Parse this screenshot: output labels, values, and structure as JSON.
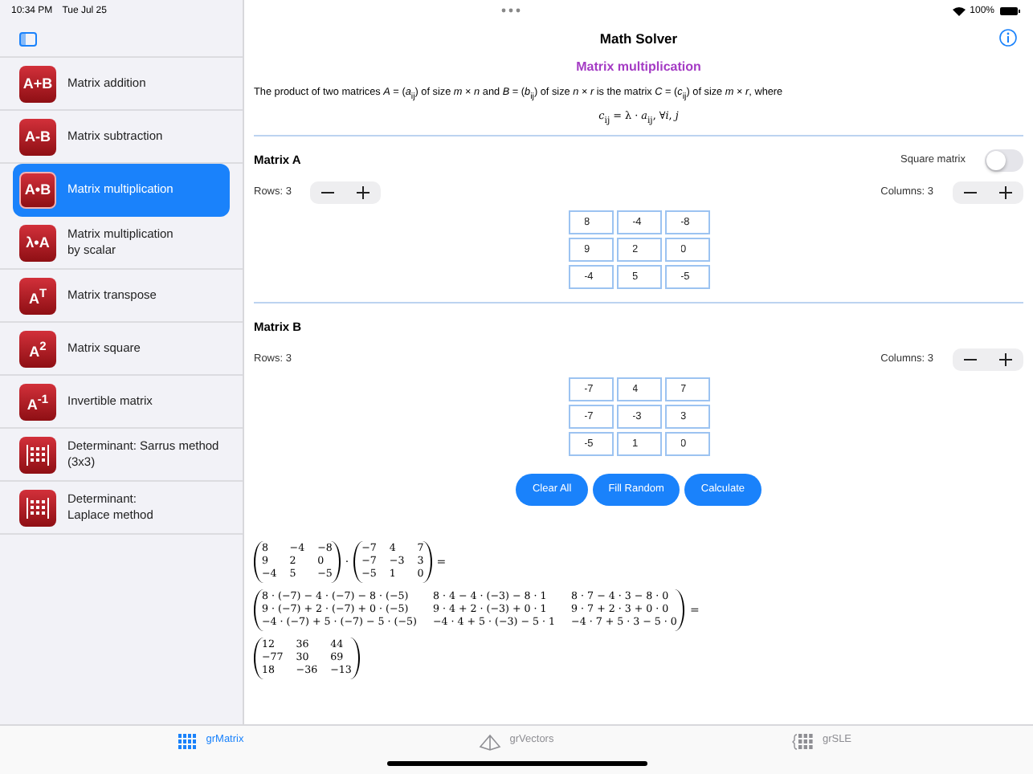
{
  "status_bar": {
    "time": "10:34 PM",
    "date": "Tue Jul 25",
    "battery": "100%"
  },
  "header": {
    "title": "Math Solver"
  },
  "sidebar": {
    "items": [
      {
        "kind": "text",
        "icon_text": "A+B",
        "label": "Matrix addition",
        "selected": false
      },
      {
        "kind": "text",
        "icon_text": "A-B",
        "label": "Matrix subtraction",
        "selected": false
      },
      {
        "kind": "text",
        "icon_text": "A•B",
        "label": "Matrix multiplication",
        "selected": true
      },
      {
        "kind": "text",
        "icon_text": "λ•A",
        "label": "Matrix multiplication\nby scalar",
        "selected": false
      },
      {
        "kind": "text",
        "icon_text": "A$^{T}$",
        "label": "Matrix transpose",
        "selected": false
      },
      {
        "kind": "text",
        "icon_text": "A$^{2}$",
        "label": "Matrix square",
        "selected": false
      },
      {
        "kind": "text",
        "icon_text": "A$^{-1}$",
        "label": "Invertible matrix",
        "selected": false
      },
      {
        "kind": "grid",
        "label": "Determinant: Sarrus method\n(3x3)",
        "selected": false
      },
      {
        "kind": "grid",
        "label": "Determinant:\nLaplace method",
        "selected": false
      }
    ]
  },
  "content": {
    "title": "Matrix multiplication",
    "description": "The product of two matrices *A* = (*a*$_{ij}$) of size *m* × *n* and *B* = (*b*$_{ij}$) of size *n* × *r* is the matrix *C* = (*c*$_{ij}$) of size *m* × *r*, where",
    "formula": "*c*$_{ij}$ = λ · *a*$_{ij}$, ∀*i*, *j*",
    "matrices": [
      {
        "title": "Matrix A",
        "square_toggle": {
          "label": "Square matrix",
          "on": false
        },
        "rows_label": "Rows: 3",
        "rows_stepper": true,
        "columns_label": "Columns: 3",
        "cells": [
          [
            "8",
            "-4",
            "-8"
          ],
          [
            "9",
            "2",
            "0"
          ],
          [
            "-4",
            "5",
            "-5"
          ]
        ]
      },
      {
        "title": "Matrix B",
        "rows_label": "Rows: 3",
        "rows_stepper": false,
        "columns_label": "Columns: 3",
        "cells": [
          [
            "-7",
            "4",
            "7"
          ],
          [
            "-7",
            "-3",
            "3"
          ],
          [
            "-5",
            "1",
            "0"
          ]
        ]
      }
    ],
    "buttons": [
      "Clear All",
      "Fill Random",
      "Calculate"
    ],
    "solution": [
      {
        "items": [
          {
            "kind": "matrix",
            "rows": [
              [
                "8",
                "−4",
                "−8"
              ],
              [
                "9",
                "2",
                "0"
              ],
              [
                "−4",
                "5",
                "−5"
              ]
            ]
          },
          {
            "kind": "operator",
            "text": "·"
          },
          {
            "kind": "matrix",
            "rows": [
              [
                "−7",
                "4",
                "7"
              ],
              [
                "−7",
                "−3",
                "3"
              ],
              [
                "−5",
                "1",
                "0"
              ]
            ]
          },
          {
            "kind": "operator",
            "text": "="
          }
        ]
      },
      {
        "items": [
          {
            "kind": "matrix",
            "rows": [
              [
                "8 · (−7) − 4 · (−7) − 8 · (−5)",
                "8 · 4 − 4 · (−3) − 8 · 1",
                "8 · 7 − 4 · 3 − 8 · 0"
              ],
              [
                "9 · (−7) + 2 · (−7) + 0 · (−5)",
                "9 · 4 + 2 · (−3) + 0 · 1",
                "9 · 7 + 2 · 3 + 0 · 0"
              ],
              [
                "−4 · (−7) + 5 · (−7) − 5 · (−5)",
                "−4 · 4 + 5 · (−3) − 5 · 1",
                "−4 · 7 + 5 · 3 − 5 · 0"
              ]
            ]
          },
          {
            "kind": "operator",
            "text": "="
          }
        ]
      },
      {
        "items": [
          {
            "kind": "matrix",
            "rows": [
              [
                "12",
                "36",
                "44"
              ],
              [
                "−77",
                "30",
                "69"
              ],
              [
                "18",
                "−36",
                "−13"
              ]
            ]
          }
        ]
      }
    ]
  },
  "tab_bar": [
    {
      "label": "grMatrix",
      "selected": true
    },
    {
      "label": "grVectors",
      "selected": false
    },
    {
      "label": "grSLE",
      "selected": false
    }
  ]
}
